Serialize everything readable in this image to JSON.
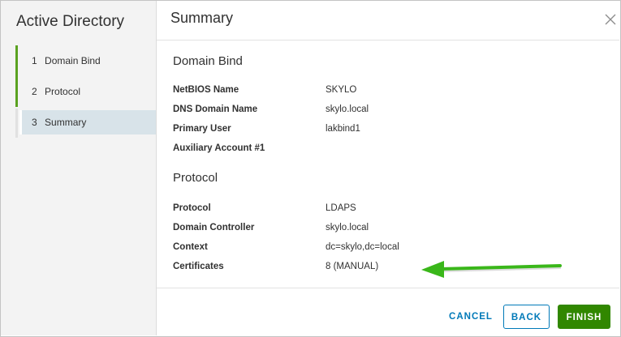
{
  "wizard": {
    "title": "Active Directory",
    "steps": [
      {
        "num": "1",
        "label": "Domain Bind",
        "state": "done"
      },
      {
        "num": "2",
        "label": "Protocol",
        "state": "done"
      },
      {
        "num": "3",
        "label": "Summary",
        "state": "active"
      }
    ]
  },
  "main": {
    "title": "Summary",
    "sections": [
      {
        "title": "Domain Bind",
        "rows": [
          {
            "key": "NetBIOS Name",
            "value": "SKYLO"
          },
          {
            "key": "DNS Domain Name",
            "value": "skylo.local"
          },
          {
            "key": "Primary User",
            "value": "lakbind1"
          },
          {
            "key": "Auxiliary Account #1",
            "value": ""
          }
        ]
      },
      {
        "title": "Protocol",
        "rows": [
          {
            "key": "Protocol",
            "value": "LDAPS"
          },
          {
            "key": "Domain Controller",
            "value": "skylo.local"
          },
          {
            "key": "Context",
            "value": "dc=skylo,dc=local"
          },
          {
            "key": "Certificates",
            "value": "8 (MANUAL)"
          }
        ]
      }
    ]
  },
  "footer": {
    "cancel_label": "CANCEL",
    "back_label": "BACK",
    "finish_label": "FINISH"
  },
  "icons": {
    "close": "close-icon",
    "annotation": "green-arrow-icon"
  },
  "colors": {
    "accent": "#0079b8",
    "finish": "#318700",
    "step_done": "#5aa220",
    "step_active_bg": "#d8e3e9",
    "arrow": "#3ab71a"
  }
}
